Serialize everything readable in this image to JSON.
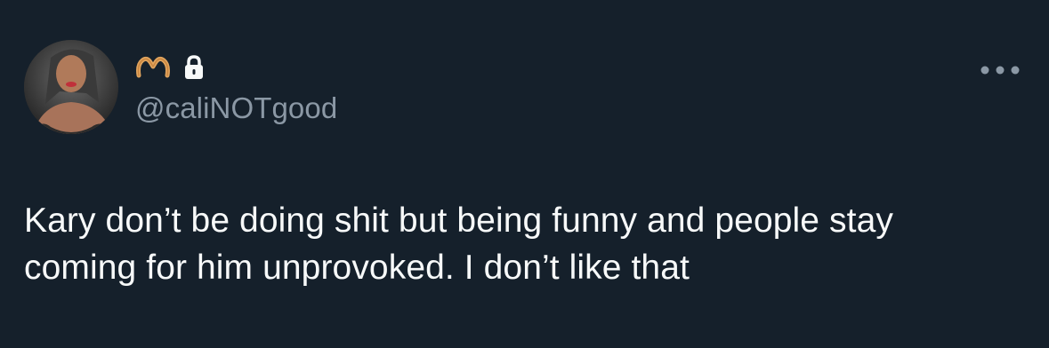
{
  "author": {
    "handle": "@caliNOTgood",
    "name_emoji_icon": "heart-hands-icon",
    "protected_icon": "lock-icon"
  },
  "actions": {
    "more_icon": "more-dots-icon"
  },
  "tweet": {
    "text": "Kary don’t be doing shit but being funny and people stay\ncoming for him unprovoked. I don’t like that"
  },
  "colors": {
    "background": "#15202b",
    "text_primary": "#f7f9f9",
    "text_secondary": "#8b98a5",
    "emoji_skin": "#e0a45e"
  }
}
